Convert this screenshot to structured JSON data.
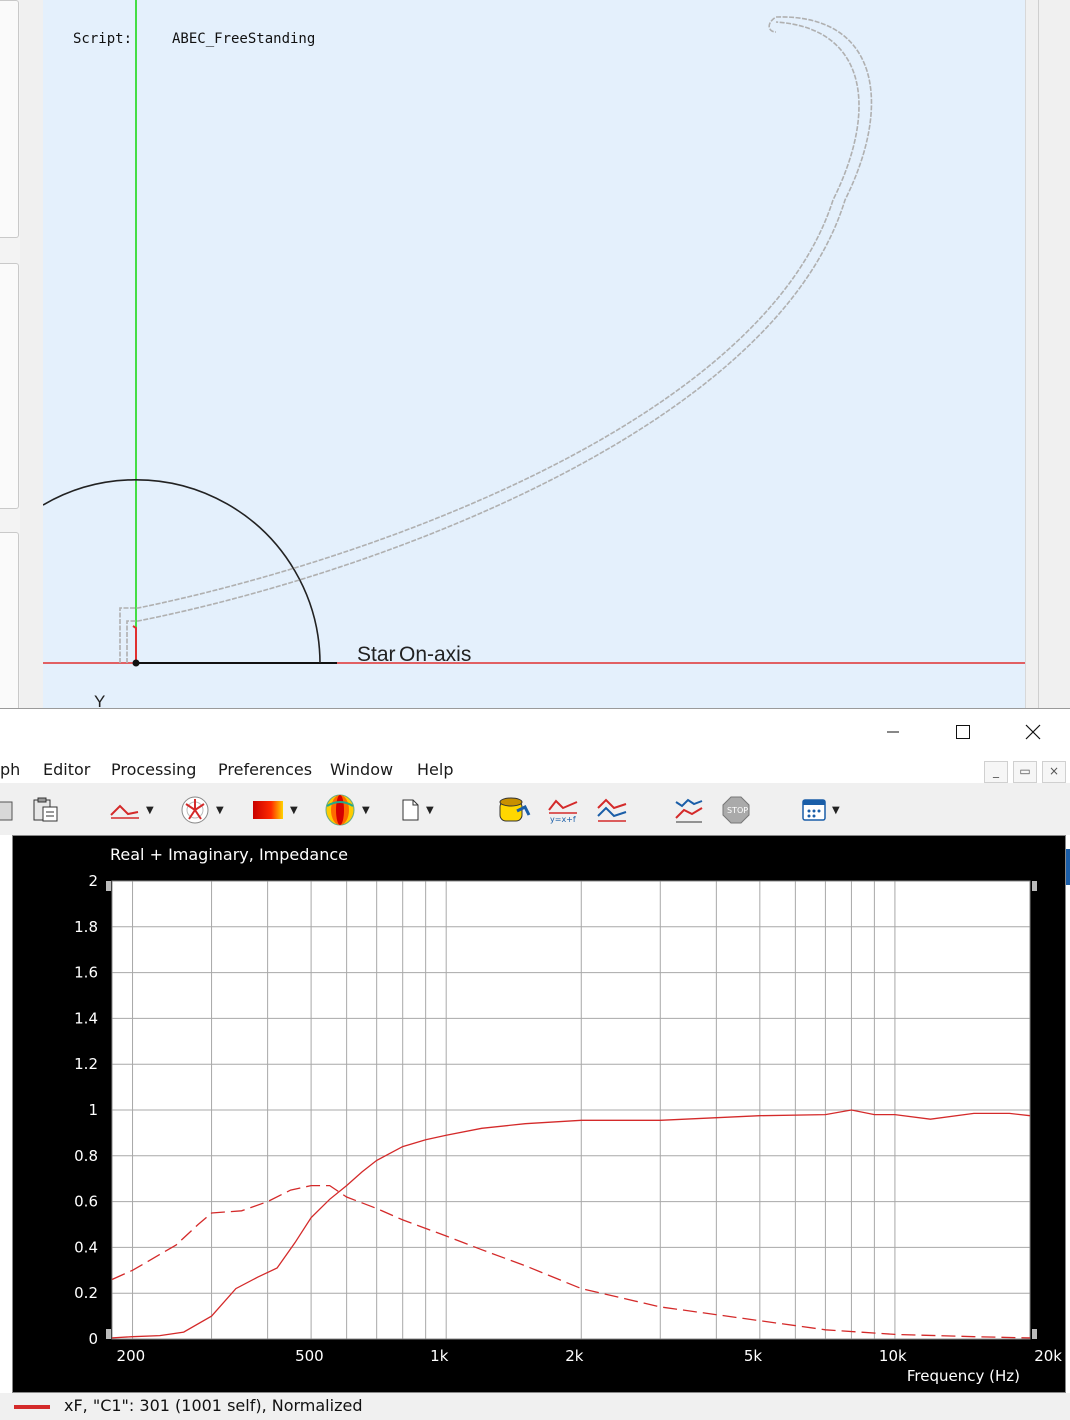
{
  "abec": {
    "script_label": "Script:",
    "script_value": "ABEC_FreeStanding",
    "start_label": "Star",
    "onaxis_label": "On-axis",
    "y_axis_label": "Y",
    "colors": {
      "background": "#e4f0fc",
      "axis_green": "#44dd44",
      "axis_red": "#e03030",
      "horn_outline": "#a8a8a8",
      "arc": "#222222"
    }
  },
  "window": {
    "minimize_icon": "minimize-icon",
    "maximize_icon": "maximize-icon",
    "close_icon": "close-icon"
  },
  "menubar": {
    "items": [
      "ph",
      "Editor",
      "Processing",
      "Preferences",
      "Window",
      "Help"
    ],
    "mdi_minimize": "_",
    "mdi_restore": "▭",
    "mdi_close": "×"
  },
  "toolbar": {
    "icons": [
      "paste-icon",
      "paste-special-icon",
      "curve-style-icon",
      "polar-icon",
      "colormap-icon",
      "balloon-icon",
      "new-page-icon",
      "import-icon",
      "formula-icon",
      "overlay-icon",
      "trend-icon",
      "stop-icon",
      "layout-icon"
    ]
  },
  "graph": {
    "title": "Real + Imaginary, Impedance",
    "legend_text": "xF, \"C1\": 301 (1001 self), Normalized",
    "series_color": "#d42a2a"
  },
  "chart_data": {
    "type": "line",
    "title": "Real + Imaginary, Impedance",
    "xlabel": "Frequency  (Hz)",
    "ylabel": "",
    "x_scale": "log",
    "xlim": [
      180,
      20000
    ],
    "ylim": [
      0,
      2
    ],
    "x_ticks": [
      200,
      500,
      1000,
      2000,
      5000,
      10000,
      20000
    ],
    "x_tick_labels": [
      "200",
      "500",
      "1k",
      "2k",
      "5k",
      "10k",
      "20k"
    ],
    "y_ticks": [
      0,
      0.2,
      0.4,
      0.6,
      0.8,
      1,
      1.2,
      1.4,
      1.6,
      1.8,
      2
    ],
    "y_tick_labels": [
      "0",
      "0.2",
      "0.4",
      "0.6",
      "0.8",
      "1",
      "1.2",
      "1.4",
      "1.6",
      "1.8",
      "2"
    ],
    "grid": true,
    "series": [
      {
        "style": "solid",
        "x": [
          180,
          200,
          230,
          260,
          300,
          340,
          380,
          420,
          460,
          500,
          550,
          600,
          650,
          700,
          800,
          900,
          1000,
          1200,
          1500,
          2000,
          3000,
          5000,
          7000,
          8000,
          9000,
          10000,
          12000,
          15000,
          18000,
          20000
        ],
        "y": [
          0.005,
          0.01,
          0.015,
          0.03,
          0.1,
          0.22,
          0.27,
          0.31,
          0.42,
          0.53,
          0.61,
          0.67,
          0.73,
          0.78,
          0.84,
          0.87,
          0.89,
          0.92,
          0.94,
          0.955,
          0.955,
          0.975,
          0.98,
          1.0,
          0.98,
          0.98,
          0.96,
          0.985,
          0.985,
          0.975
        ]
      },
      {
        "style": "dashed",
        "x": [
          180,
          200,
          250,
          280,
          300,
          350,
          400,
          450,
          500,
          550,
          600,
          700,
          800,
          1000,
          1200,
          1500,
          2000,
          3000,
          5000,
          7000,
          10000,
          15000,
          20000
        ],
        "y": [
          0.26,
          0.3,
          0.41,
          0.5,
          0.55,
          0.56,
          0.6,
          0.65,
          0.67,
          0.67,
          0.62,
          0.57,
          0.52,
          0.45,
          0.39,
          0.32,
          0.22,
          0.14,
          0.08,
          0.04,
          0.02,
          0.01,
          0.005
        ]
      }
    ]
  }
}
